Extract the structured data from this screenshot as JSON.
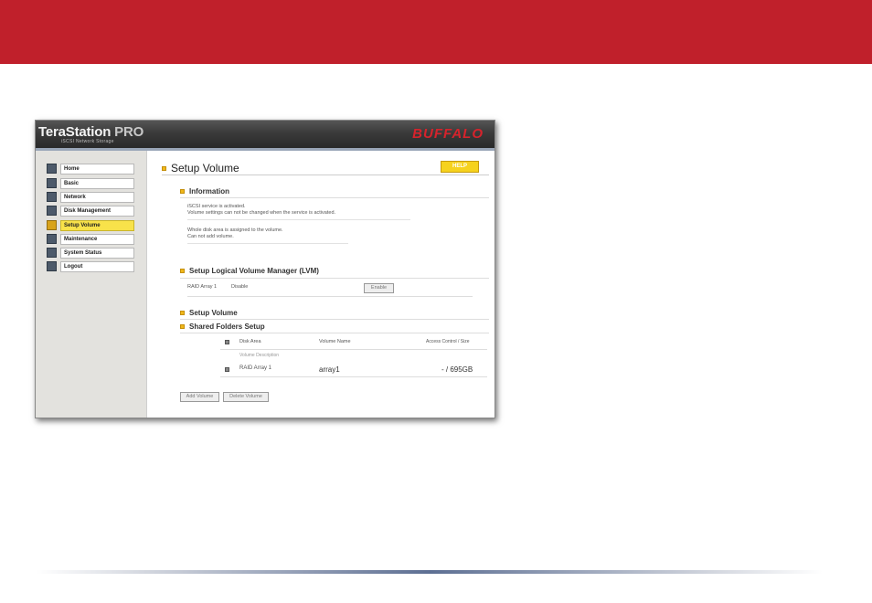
{
  "colors": {
    "banner": "#c0202b",
    "accent": "#f8e24a",
    "help": "#f6d21e"
  },
  "terastation": {
    "logo_main": "TeraStation",
    "logo_pro": "PRO",
    "logo_sub": "iSCSI Network Storage",
    "brand": "BUFFALO"
  },
  "sidebar": {
    "items": [
      {
        "label": "Home",
        "icon": "home-icon"
      },
      {
        "label": "Basic",
        "icon": "basic-icon"
      },
      {
        "label": "Network",
        "icon": "network-icon"
      },
      {
        "label": "Disk Management",
        "icon": "disk-icon"
      },
      {
        "label": "Setup Volume",
        "icon": "volume-icon"
      },
      {
        "label": "Maintenance",
        "icon": "maintenance-icon"
      },
      {
        "label": "System Status",
        "icon": "status-icon"
      },
      {
        "label": "Logout",
        "icon": "logout-icon"
      }
    ]
  },
  "main": {
    "title": "Setup Volume",
    "help": "HELP",
    "information": {
      "heading": "Information",
      "line1": "iSCSI service is activated.",
      "line2": "Volume settings can not be changed when the service is activated.",
      "line3": "Whole disk area is assigned to the volume.",
      "line4": "Can not add volume."
    },
    "lvm": {
      "heading": "Setup Logical Volume Manager (LVM)",
      "array": "RAID Array 1",
      "status": "Disable",
      "button": "Enable"
    },
    "setup_volume": {
      "heading": "Setup Volume"
    },
    "shared": {
      "heading": "Shared Folders Setup",
      "col_disk": "Disk Area",
      "col_name": "Volume Name",
      "col_access": "Access Control / Size",
      "sub_desc": "Volume Description",
      "row_disk": "RAID Array 1",
      "row_name": "array1",
      "row_size": "- / 695GB"
    },
    "buttons": {
      "add": "Add Volume",
      "delete": "Delete Volume"
    }
  }
}
